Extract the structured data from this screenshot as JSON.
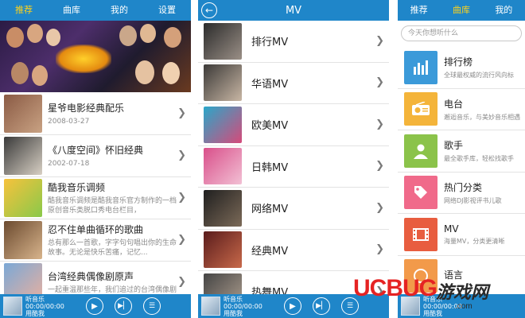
{
  "screen1": {
    "tabs": [
      {
        "label": "推荐",
        "active": true
      },
      {
        "label": "曲库",
        "active": false
      },
      {
        "label": "我的",
        "active": false
      },
      {
        "label": "设置",
        "active": false
      }
    ],
    "items": [
      {
        "title": "星爷电影经典配乐",
        "sub": "2008-03-27"
      },
      {
        "title": "《八度空间》怀旧经典",
        "sub": "2002-07-18"
      },
      {
        "title": "酷我音乐调频",
        "sub": "酷我音乐调频是酷我音乐官方制作的一档原创音乐类脱口秀电台栏目，"
      },
      {
        "title": "忍不住单曲循环的歌曲",
        "sub": "总有那么一首歌，字字句句唱出你的生命故事。无论是快乐苦痛，记忆..."
      },
      {
        "title": "台湾经典偶像剧原声",
        "sub": "一起重温那些年，我们追过的台湾偶像剧"
      }
    ]
  },
  "screen2": {
    "title": "MV",
    "items": [
      "排行MV",
      "华语MV",
      "欧美MV",
      "日韩MV",
      "网络MV",
      "经典MV",
      "热舞MV"
    ]
  },
  "screen3": {
    "tabs": [
      {
        "label": "推荐",
        "active": false
      },
      {
        "label": "曲库",
        "active": true
      },
      {
        "label": "我的",
        "active": false
      }
    ],
    "search_placeholder": "今天你想听什么",
    "items": [
      {
        "title": "排行榜",
        "sub": "全球最权威的流行风向标",
        "icon": "bar-chart-icon",
        "color": "#3b9ad9"
      },
      {
        "title": "电台",
        "sub": "邂逅音乐，与美妙音乐相遇",
        "icon": "radio-icon",
        "color": "#f4b43a"
      },
      {
        "title": "歌手",
        "sub": "最全歌手库，轻松找歌手",
        "icon": "singer-icon",
        "color": "#8bc34a"
      },
      {
        "title": "热门分类",
        "sub": "网络DJ影视评书儿歌",
        "icon": "tag-icon",
        "color": "#f06a8a"
      },
      {
        "title": "MV",
        "sub": "海量MV，分类更清晰",
        "icon": "film-icon",
        "color": "#e85d3f"
      },
      {
        "title": "语言",
        "sub": "",
        "icon": "language-icon",
        "color": "#f29a4a"
      }
    ]
  },
  "player": {
    "line1": "听音乐",
    "line2": "00:00/00:00",
    "line3": "用酷我"
  },
  "watermark": {
    "brand": "UCBUG",
    "cn": "游戏网",
    "url": ".com"
  }
}
